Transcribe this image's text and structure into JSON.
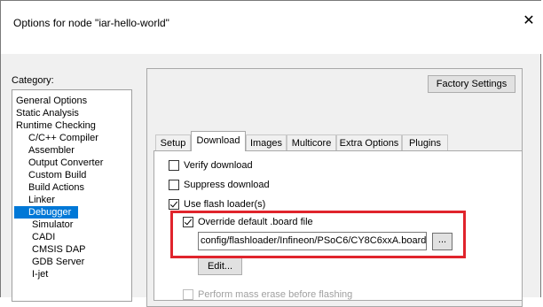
{
  "window": {
    "title": "Options for node \"iar-hello-world\"",
    "close_glyph": "✕"
  },
  "category": {
    "label": "Category:",
    "items": [
      {
        "label": "General Options",
        "indent": 0,
        "selected": false
      },
      {
        "label": "Static Analysis",
        "indent": 0,
        "selected": false
      },
      {
        "label": "Runtime Checking",
        "indent": 0,
        "selected": false
      },
      {
        "label": "C/C++ Compiler",
        "indent": 1,
        "selected": false
      },
      {
        "label": "Assembler",
        "indent": 1,
        "selected": false
      },
      {
        "label": "Output Converter",
        "indent": 1,
        "selected": false
      },
      {
        "label": "Custom Build",
        "indent": 1,
        "selected": false
      },
      {
        "label": "Build Actions",
        "indent": 1,
        "selected": false
      },
      {
        "label": "Linker",
        "indent": 1,
        "selected": false
      },
      {
        "label": "Debugger",
        "indent": 1,
        "selected": true
      },
      {
        "label": "Simulator",
        "indent": 2,
        "selected": false
      },
      {
        "label": "CADI",
        "indent": 2,
        "selected": false
      },
      {
        "label": "CMSIS DAP",
        "indent": 2,
        "selected": false
      },
      {
        "label": "GDB Server",
        "indent": 2,
        "selected": false
      },
      {
        "label": "I-jet",
        "indent": 2,
        "selected": false
      }
    ]
  },
  "factory_settings_label": "Factory Settings",
  "tabs": [
    {
      "label": "Setup",
      "active": false
    },
    {
      "label": "Download",
      "active": true
    },
    {
      "label": "Images",
      "active": false
    },
    {
      "label": "Multicore",
      "active": false
    },
    {
      "label": "Extra Options",
      "active": false
    },
    {
      "label": "Plugins",
      "active": false
    }
  ],
  "download": {
    "verify": {
      "label": "Verify download",
      "checked": false
    },
    "suppress": {
      "label": "Suppress download",
      "checked": false
    },
    "use_flash_loaders": {
      "label": "Use flash loader(s)",
      "checked": true
    },
    "override_board": {
      "label": "Override default .board file",
      "checked": true
    },
    "board_file_path": "config/flashloader/Infineon/PSoC6/CY8C6xxA.board",
    "browse_label": "...",
    "edit_label": "Edit...",
    "mass_erase": {
      "label": "Perform mass erase before flashing",
      "checked": false,
      "disabled": true
    }
  },
  "colors": {
    "selection": "#0078d7",
    "highlight_border": "#e0242c",
    "dialog_bg": "#f0f0f0"
  },
  "icons": {
    "close": "close-icon"
  }
}
